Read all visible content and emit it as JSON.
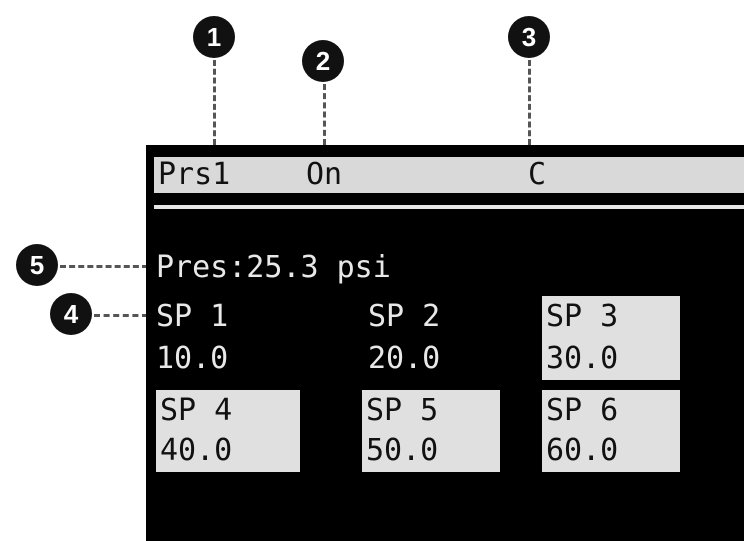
{
  "callouts": [
    "1",
    "2",
    "3",
    "4",
    "5"
  ],
  "header": {
    "program": "Prs1",
    "state": "On",
    "mode": "C"
  },
  "pressure": {
    "text": "Pres:25.3 psi"
  },
  "setpoints": [
    {
      "label": "SP 1",
      "value": "10.0",
      "highlighted": false
    },
    {
      "label": "SP 2",
      "value": "20.0",
      "highlighted": false
    },
    {
      "label": "SP 3",
      "value": "30.0",
      "highlighted": true
    },
    {
      "label": "SP 4",
      "value": "40.0",
      "highlighted": true
    },
    {
      "label": "SP 5",
      "value": "50.0",
      "highlighted": true
    },
    {
      "label": "SP 6",
      "value": "60.0",
      "highlighted": true
    }
  ],
  "colors": {
    "screen_bg": "#000000",
    "highlight_bg": "#e0e0e0",
    "lcd_text": "#e8e8e8",
    "callout_bg": "#111111"
  }
}
